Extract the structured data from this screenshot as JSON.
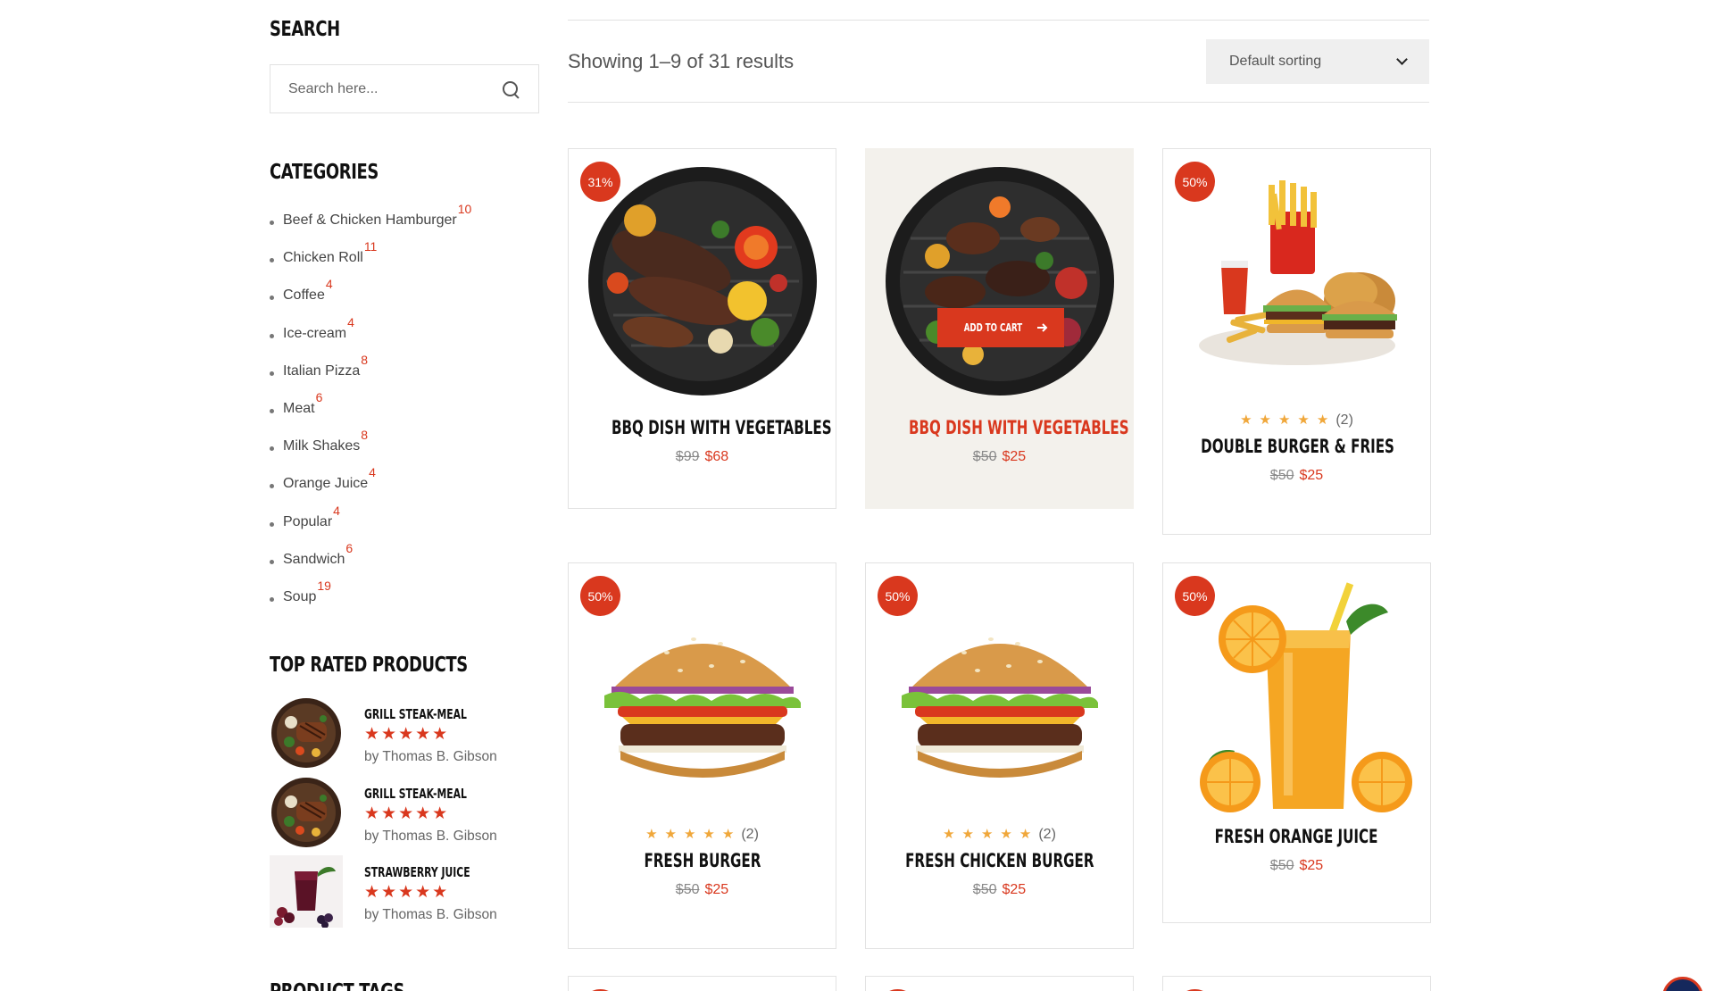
{
  "sidebar": {
    "search": {
      "title": "Search",
      "placeholder": "Search here..."
    },
    "categories": {
      "title": "Categories",
      "items": [
        {
          "label": "Beef & Chicken Hamburger",
          "count": "10"
        },
        {
          "label": "Chicken Roll",
          "count": "11"
        },
        {
          "label": "Coffee",
          "count": "4"
        },
        {
          "label": "Ice-cream",
          "count": "4"
        },
        {
          "label": "Italian Pizza",
          "count": "8"
        },
        {
          "label": "Meat",
          "count": "6"
        },
        {
          "label": "Milk Shakes",
          "count": "8"
        },
        {
          "label": "Orange Juice",
          "count": "4"
        },
        {
          "label": "Popular",
          "count": "4"
        },
        {
          "label": "Sandwich",
          "count": "6"
        },
        {
          "label": "Soup",
          "count": "19"
        }
      ]
    },
    "top_rated": {
      "title": "Top Rated Products",
      "items": [
        {
          "name": "Grill Steak-Meal",
          "stars": "★★★★★",
          "by": "by Thomas B. Gibson"
        },
        {
          "name": "Grill Steak-Meal",
          "stars": "★★★★★",
          "by": "by Thomas B. Gibson"
        },
        {
          "name": "Strawberry Juice",
          "stars": "★★★★★",
          "by": "by Thomas B. Gibson"
        }
      ]
    },
    "tags": {
      "title": "Product Tags"
    }
  },
  "shop": {
    "result_count": "Showing 1–9 of 31 results",
    "sorting": "Default sorting",
    "add_to_cart": "Add to cart",
    "products": [
      {
        "badge": "31%",
        "name": "BBQ Dish with Vegetables",
        "old_price": "$99",
        "new_price": "$68"
      },
      {
        "badge": "",
        "name": "BBQ Dish with Vegetables",
        "old_price": "$50",
        "new_price": "$25"
      },
      {
        "badge": "50%",
        "name": "Double Burger & Fries",
        "stars": "★★★★★",
        "reviews": "(2)",
        "old_price": "$50",
        "new_price": "$25"
      },
      {
        "badge": "50%",
        "name": "Fresh Burger",
        "stars": "★★★★★",
        "reviews": "(2)",
        "old_price": "$50",
        "new_price": "$25"
      },
      {
        "badge": "50%",
        "name": "Fresh Chicken Burger",
        "stars": "★★★★★",
        "reviews": "(2)",
        "old_price": "$50",
        "new_price": "$25"
      },
      {
        "badge": "50%",
        "name": "Fresh Orange Juice",
        "old_price": "$50",
        "new_price": "$25"
      }
    ]
  },
  "colors": {
    "accent": "#d9381e",
    "star": "#f0a73a",
    "hover_bg": "#f3f1ec",
    "back_to_top": "#15285c"
  }
}
